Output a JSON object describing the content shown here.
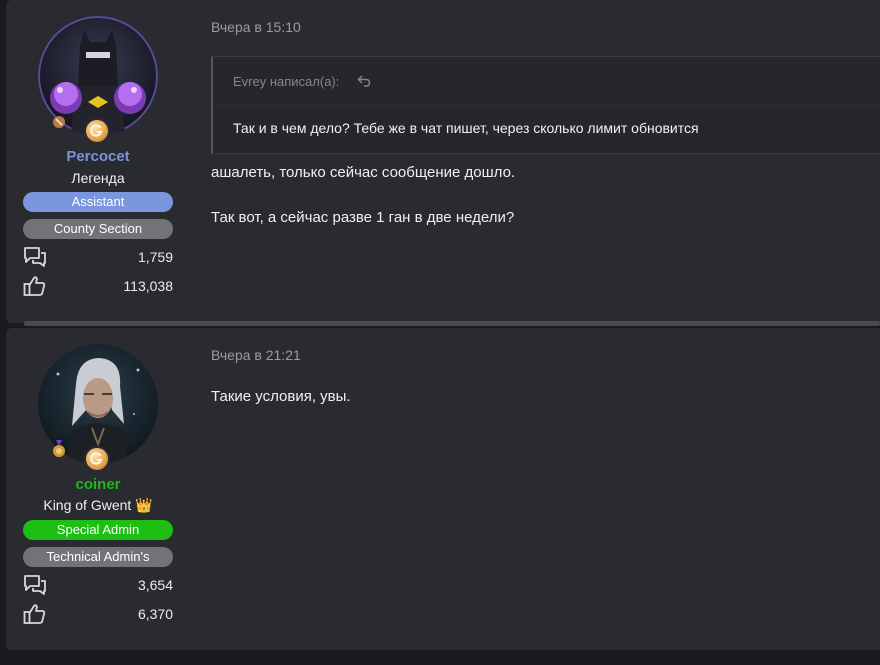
{
  "posts": [
    {
      "user": {
        "name": "Percocet",
        "name_color": "#7b93d8",
        "title": "Легенда",
        "banners": [
          {
            "label": "Assistant",
            "color": "#7b96de"
          },
          {
            "label": "County Section",
            "color": "#727377"
          }
        ],
        "messages_count": "1,759",
        "reactions_count": "113,038"
      },
      "date": "Вчера в 15:10",
      "quote": {
        "author": "Evrey написал(а):",
        "text": "Так и в чем дело? Тебе же в чат пишет, через сколько лимит обновится"
      },
      "lines": [
        "ашалеть, только сейчас сообщение дошло.",
        "Так вот, а сейчас разве 1 ган в две недели?"
      ]
    },
    {
      "user": {
        "name": "coiner",
        "name_color": "#22b81c",
        "title": "King of Gwent 👑",
        "banners": [
          {
            "label": "Special Admin",
            "color": "#1dbf12"
          },
          {
            "label": "Technical Admin's",
            "color": "#727377"
          }
        ],
        "messages_count": "3,654",
        "reactions_count": "6,370"
      },
      "date": "Вчера в 21:21",
      "lines": [
        "Такие условия, увы."
      ]
    }
  ]
}
